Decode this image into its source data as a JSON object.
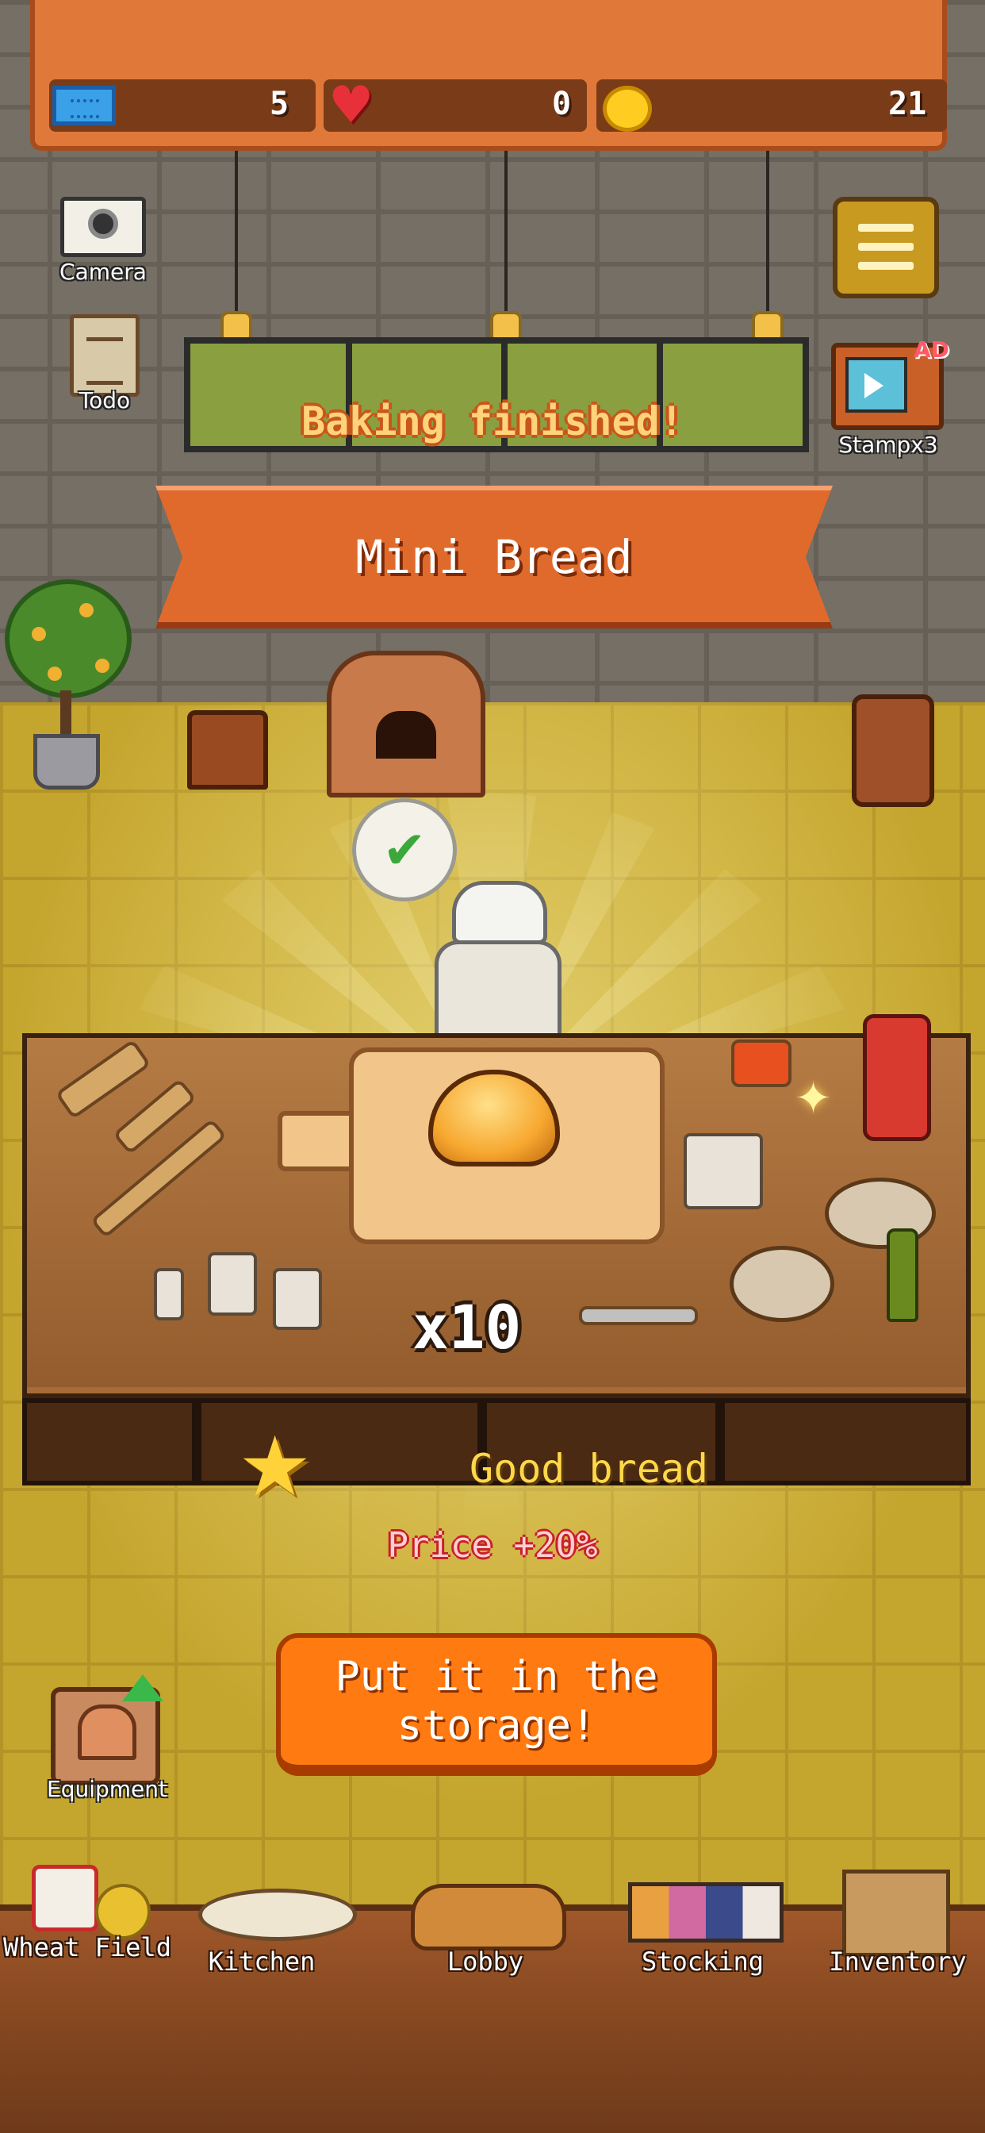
{
  "hud": {
    "tickets": "5",
    "hearts": "0",
    "coins": "21"
  },
  "side": {
    "camera_label": "Camera",
    "todo_label": "Todo",
    "stamp_label": "Stampx3",
    "ad_tag": "AD"
  },
  "result": {
    "status": "Baking finished!",
    "item_name": "Mini Bread",
    "quantity": "x10",
    "rating": "Good bread",
    "bonus": "Price +20%"
  },
  "actions": {
    "store_button": "Put it in the storage!",
    "equipment_label": "Equipment"
  },
  "nav": {
    "items": [
      {
        "label": "Wheat Field",
        "icon": "wheat-field-icon"
      },
      {
        "label": "Kitchen",
        "icon": "kitchen-icon"
      },
      {
        "label": "Lobby",
        "icon": "lobby-icon"
      },
      {
        "label": "Stocking",
        "icon": "stocking-icon"
      },
      {
        "label": "Inventory",
        "icon": "inventory-icon"
      }
    ]
  },
  "colors": {
    "accent": "#ff7a10",
    "banner": "#e06a2c",
    "rating": "#ffd84a",
    "bonus": "#ff3a3a"
  }
}
